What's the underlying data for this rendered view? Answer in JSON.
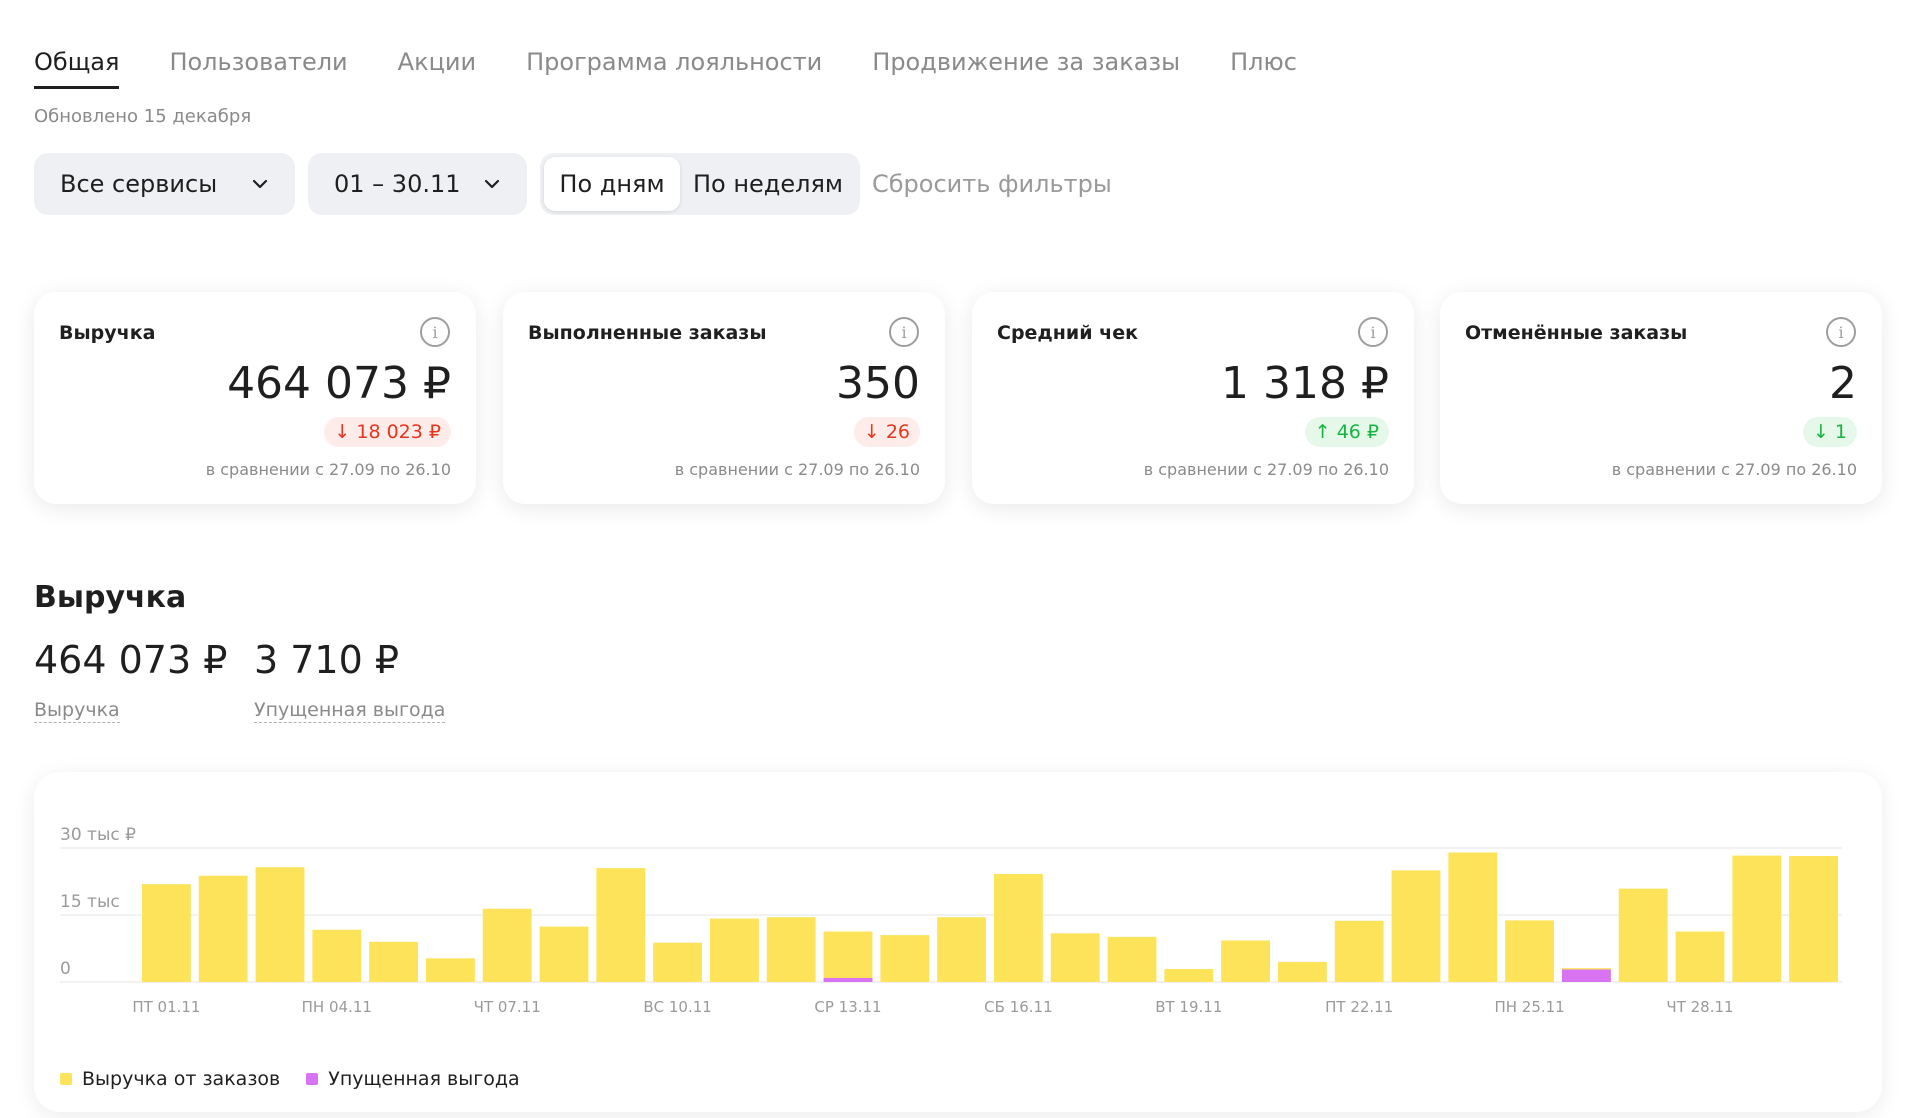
{
  "tabs": [
    "Общая",
    "Пользователи",
    "Акции",
    "Программа лояльности",
    "Продвижение за заказы",
    "Плюс"
  ],
  "updated": "Обновлено 15 декабря",
  "filters": {
    "services": "Все сервисы",
    "period": "01 – 30.11",
    "by_days": "По дням",
    "by_weeks": "По неделям",
    "reset": "Сбросить фильтры"
  },
  "cards": [
    {
      "title": "Выручка",
      "value": "464 073 ₽",
      "delta": "↓ 18 023 ₽",
      "trend": "neg",
      "compare": "в сравнении с 27.09 по 26.10"
    },
    {
      "title": "Выполненные заказы",
      "value": "350",
      "delta": "↓ 26",
      "trend": "neg",
      "compare": "в сравнении с 27.09 по 26.10"
    },
    {
      "title": "Средний чек",
      "value": "1 318 ₽",
      "delta": "↑ 46 ₽",
      "trend": "pos",
      "compare": "в сравнении с 27.09 по 26.10"
    },
    {
      "title": "Отменённые заказы",
      "value": "2",
      "delta": "↓ 1",
      "trend": "pos",
      "compare": "в сравнении с 27.09 по 26.10"
    }
  ],
  "revenue": {
    "title": "Выручка",
    "total": "464 073 ₽",
    "total_label": "Выручка",
    "lost": "3 710 ₽",
    "lost_label": "Упущенная выгода"
  },
  "colors": {
    "revenue": "#fce35a",
    "lost": "#d873f2",
    "grid": "#e6e6e6"
  },
  "chart_data": {
    "type": "bar",
    "stacked": true,
    "y_ticks": [
      {
        "value": 30000,
        "label": "30 тыс ₽"
      },
      {
        "value": 15000,
        "label": "15 тыс"
      },
      {
        "value": 0,
        "label": "0"
      }
    ],
    "ylim": [
      0,
      30000
    ],
    "grid": true,
    "legend_position": "bottom-left",
    "x_ticks": [
      {
        "index": 0,
        "label": "ПТ 01.11"
      },
      {
        "index": 3,
        "label": "ПН 04.11"
      },
      {
        "index": 6,
        "label": "ЧТ 07.11"
      },
      {
        "index": 9,
        "label": "ВС 10.11"
      },
      {
        "index": 12,
        "label": "СР 13.11"
      },
      {
        "index": 15,
        "label": "СБ 16.11"
      },
      {
        "index": 18,
        "label": "ВТ 19.11"
      },
      {
        "index": 21,
        "label": "ПТ 22.11"
      },
      {
        "index": 24,
        "label": "ПН 25.11"
      },
      {
        "index": 27,
        "label": "ЧТ 28.11"
      }
    ],
    "categories": [
      "01.11",
      "02.11",
      "03.11",
      "04.11",
      "05.11",
      "06.11",
      "07.11",
      "08.11",
      "09.11",
      "10.11",
      "11.11",
      "12.11",
      "13.11",
      "14.11",
      "15.11",
      "16.11",
      "17.11",
      "18.11",
      "19.11",
      "20.11",
      "21.11",
      "22.11",
      "23.11",
      "24.11",
      "25.11",
      "26.11",
      "27.11",
      "28.11",
      "29.11",
      "30.11"
    ],
    "series": [
      {
        "name": "Выручка от заказов",
        "values": [
          21900,
          23800,
          25700,
          11700,
          9000,
          5300,
          16400,
          12400,
          25500,
          8800,
          14200,
          14500,
          11300,
          10500,
          14500,
          24200,
          10900,
          10100,
          2900,
          9300,
          4500,
          13700,
          25000,
          29000,
          13800,
          3100,
          20900,
          11300,
          28300,
          28200
        ]
      },
      {
        "name": "Упущенная выгода",
        "values": [
          0,
          0,
          0,
          0,
          0,
          0,
          0,
          0,
          0,
          0,
          0,
          0,
          900,
          0,
          0,
          0,
          0,
          0,
          0,
          0,
          0,
          0,
          0,
          0,
          0,
          2800,
          0,
          0,
          0,
          0
        ]
      }
    ]
  }
}
